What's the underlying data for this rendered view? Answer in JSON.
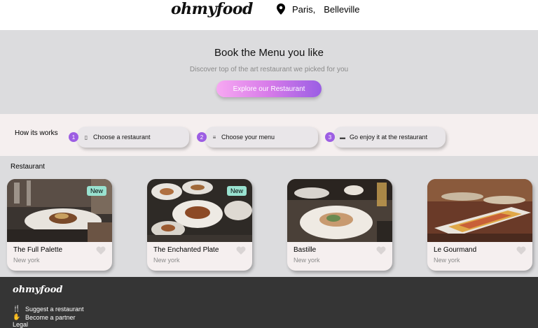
{
  "header": {
    "logo": "ohmyfood",
    "city": "Paris,",
    "district": "Belleville"
  },
  "hero": {
    "title": "Book the Menu you like",
    "subtitle": "Discover top of the art restaurant we picked for you",
    "cta_label": "Explore our Restaurant"
  },
  "how": {
    "title": "How its works",
    "steps": [
      {
        "number": "1",
        "icon": "phone-icon",
        "label": "Choose a restaurant"
      },
      {
        "number": "2",
        "icon": "list-icon",
        "label": "Choose your menu"
      },
      {
        "number": "3",
        "icon": "computer-icon",
        "label": "Go enjoy it at the restaurant"
      }
    ]
  },
  "restaurants": {
    "title": "Restaurant",
    "items": [
      {
        "name": "The Full Palette",
        "location": "New york",
        "badge": "New"
      },
      {
        "name": "The Enchanted Plate",
        "location": "New york",
        "badge": "New"
      },
      {
        "name": "Bastille",
        "location": "New york",
        "badge": ""
      },
      {
        "name": "Le Gourmand",
        "location": "New york",
        "badge": ""
      }
    ]
  },
  "footer": {
    "logo": "ohmyfood",
    "links": [
      {
        "icon": "cutlery-icon",
        "label": "Suggest a restaurant"
      },
      {
        "icon": "handshake-icon",
        "label": "Become a partner"
      },
      {
        "icon": "",
        "label": "Legal"
      }
    ]
  },
  "colors": {
    "accent": "#9d5ee3",
    "badge": "#99e2d0",
    "footer_bg": "#353535",
    "hero_bg": "#dcdcde"
  }
}
